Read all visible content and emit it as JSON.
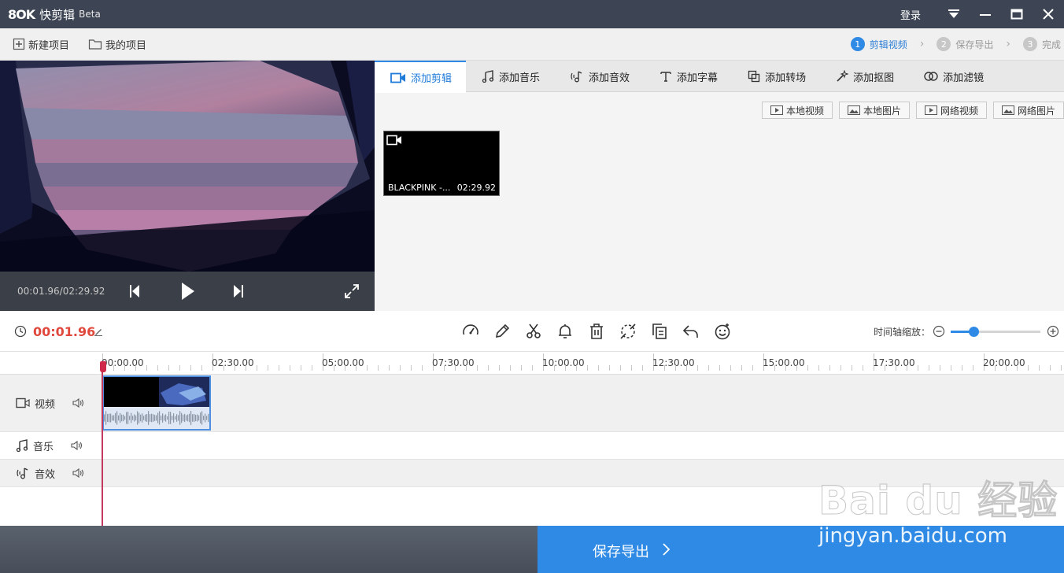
{
  "app": {
    "logo": "8OK",
    "name": "快剪辑",
    "beta": "Beta",
    "login": "登录"
  },
  "window_controls": [
    "dropdown-icon",
    "minimize-icon",
    "maximize-icon",
    "close-icon"
  ],
  "menu": {
    "new_project": "新建项目",
    "my_projects": "我的项目"
  },
  "steps": [
    {
      "num": "1",
      "label": "剪辑视频"
    },
    {
      "num": "2",
      "label": "保存导出"
    },
    {
      "num": "3",
      "label": "完成"
    }
  ],
  "player": {
    "time": "00:01.96/02:29.92"
  },
  "tabs": [
    "添加剪辑",
    "添加音乐",
    "添加音效",
    "添加字幕",
    "添加转场",
    "添加抠图",
    "添加滤镜"
  ],
  "sources": [
    "本地视频",
    "本地图片",
    "网络视频",
    "网络图片"
  ],
  "media": {
    "name": "BLACKPINK -...",
    "duration": "02:29.92"
  },
  "toolbar": {
    "current_time": "00:01.96",
    "tools": [
      "speed-icon",
      "edit-icon",
      "cut-icon",
      "bell-icon",
      "delete-icon",
      "crop-icon",
      "copy-icon",
      "undo-icon",
      "emoji-icon"
    ],
    "zoom_label": "时间轴缩放：",
    "zoom_level": 0.25
  },
  "ruler": [
    "00:00.00",
    "02:30.00",
    "05:00.00",
    "07:30.00",
    "10:00.00",
    "12:30.00",
    "15:00.00",
    "17:30.00",
    "20:00.00"
  ],
  "tracks": {
    "video": "视频",
    "music": "音乐",
    "sfx": "音效"
  },
  "footer": {
    "export": "保存导出"
  },
  "watermark": {
    "brand": "Bai du 经验",
    "url": "jingyan.baidu.com"
  },
  "colors": {
    "accent": "#2f8ae5",
    "time_red": "#e0483c",
    "titlebar": "#3d4554"
  }
}
